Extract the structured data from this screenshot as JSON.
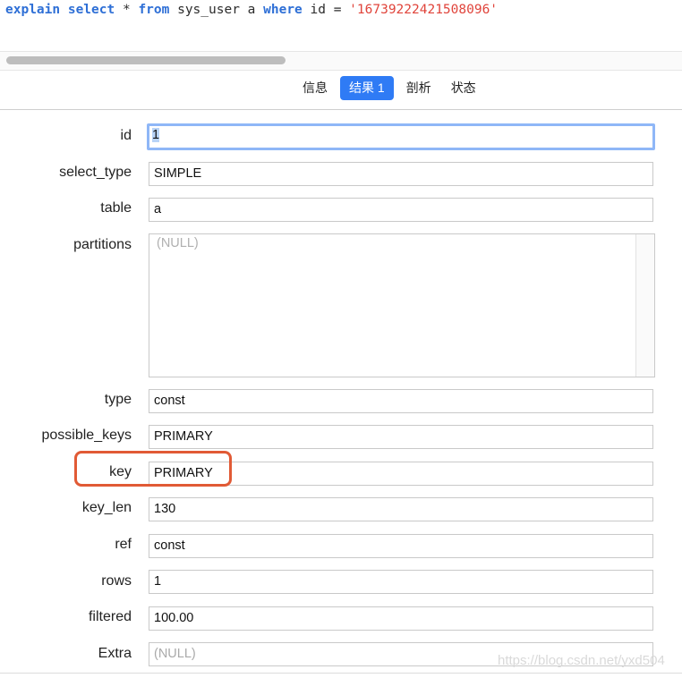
{
  "editor": {
    "sql": [
      {
        "text": "explain",
        "cls": "kw"
      },
      {
        "text": " ",
        "cls": ""
      },
      {
        "text": "select",
        "cls": "kw"
      },
      {
        "text": " * ",
        "cls": ""
      },
      {
        "text": "from",
        "cls": "kw"
      },
      {
        "text": " sys_user a ",
        "cls": ""
      },
      {
        "text": "where",
        "cls": "kw"
      },
      {
        "text": " id = ",
        "cls": ""
      },
      {
        "text": "'16739222421508096'",
        "cls": "str"
      }
    ]
  },
  "tabs": [
    {
      "label": "信息",
      "active": false,
      "name": "tab-info"
    },
    {
      "label": "结果 1",
      "active": true,
      "name": "tab-result-1"
    },
    {
      "label": "剖析",
      "active": false,
      "name": "tab-profile"
    },
    {
      "label": "状态",
      "active": false,
      "name": "tab-status"
    }
  ],
  "fields": {
    "id": {
      "label": "id",
      "value": "1"
    },
    "select_type": {
      "label": "select_type",
      "value": "SIMPLE"
    },
    "table": {
      "label": "table",
      "value": "a"
    },
    "partitions": {
      "label": "partitions",
      "value": "(NULL)"
    },
    "type": {
      "label": "type",
      "value": "const"
    },
    "possible_keys": {
      "label": "possible_keys",
      "value": "PRIMARY"
    },
    "key": {
      "label": "key",
      "value": "PRIMARY"
    },
    "key_len": {
      "label": "key_len",
      "value": "130"
    },
    "ref": {
      "label": "ref",
      "value": "const"
    },
    "rows": {
      "label": "rows",
      "value": "1"
    },
    "filtered": {
      "label": "filtered",
      "value": "100.00"
    },
    "extra": {
      "label": "Extra",
      "value": "(NULL)"
    }
  },
  "watermark": "https://blog.csdn.net/yxd504",
  "colors": {
    "accent": "#2f7bf5",
    "highlight": "#e15a35",
    "keyword": "#2e6fd6",
    "string": "#e0443b"
  }
}
